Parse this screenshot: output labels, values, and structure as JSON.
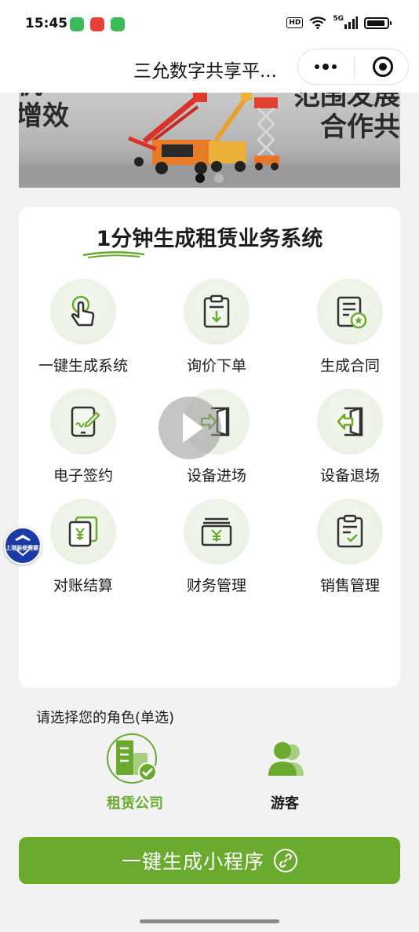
{
  "status_bar": {
    "time": "15:45",
    "network": "5G",
    "hd": "HD",
    "app_icons": [
      {
        "name": "message-app-icon",
        "color": "#3dbb5b"
      },
      {
        "name": "music-app-icon",
        "color": "#e8413b"
      },
      {
        "name": "upload-app-icon",
        "color": "#3dbb5b"
      }
    ]
  },
  "nav": {
    "title": "三允数字共享平..."
  },
  "banner": {
    "text_left": [
      "机",
      "增效"
    ],
    "text_right": [
      "范围发展",
      "合作共"
    ],
    "dots": 2,
    "active_dot": 0
  },
  "card": {
    "title": "1分钟生成租赁业务系统",
    "features": [
      {
        "label": "一键生成系统",
        "icon": "touch-click-icon"
      },
      {
        "label": "询价下单",
        "icon": "clipboard-download-icon"
      },
      {
        "label": "生成合同",
        "icon": "contract-star-icon"
      },
      {
        "label": "电子签约",
        "icon": "tablet-sign-icon"
      },
      {
        "label": "设备进场",
        "icon": "door-enter-icon"
      },
      {
        "label": "设备退场",
        "icon": "door-exit-icon"
      },
      {
        "label": "对账结算",
        "icon": "yuan-documents-icon"
      },
      {
        "label": "财务管理",
        "icon": "yuan-stack-icon"
      },
      {
        "label": "销售管理",
        "icon": "clipboard-check-icon"
      }
    ]
  },
  "float_badge": {
    "text": "上港装修需要车"
  },
  "roles": {
    "prompt": "请选择您的角色(单选)",
    "options": [
      {
        "label": "租赁公司",
        "selected": true,
        "icon": "company-building-icon"
      },
      {
        "label": "游客",
        "selected": false,
        "icon": "visitor-user-icon"
      }
    ]
  },
  "actions": {
    "generate_label": "一键生成小程序"
  },
  "colors": {
    "accent": "#6aaa2e",
    "icon_bg": "#eef3e8",
    "selected_text": "#6aaa2e"
  }
}
